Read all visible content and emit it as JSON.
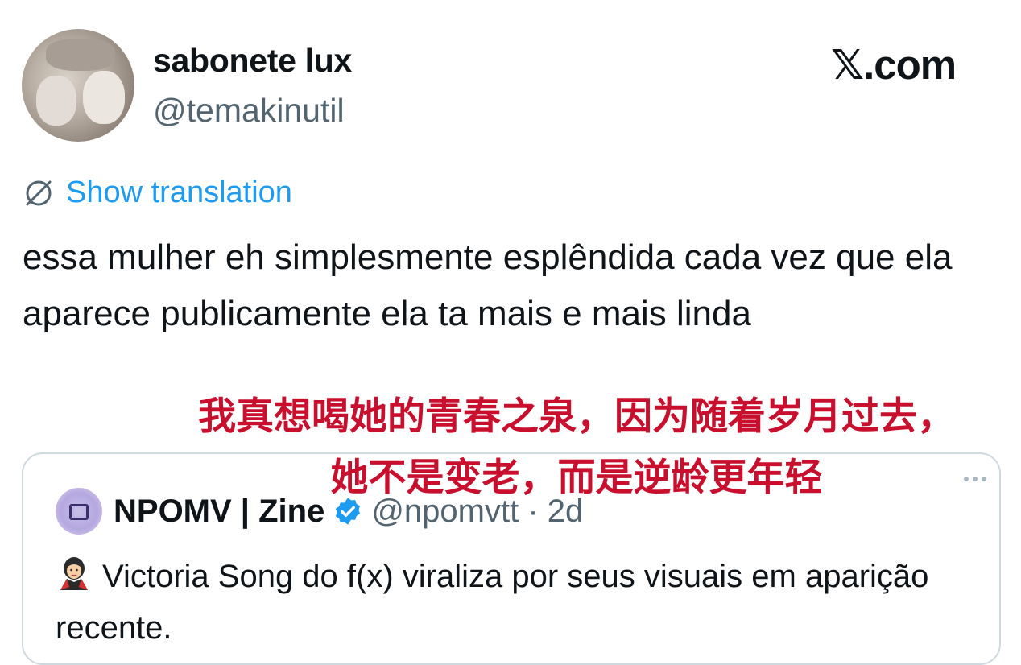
{
  "tweet": {
    "display_name": "sabonete lux",
    "handle": "@temakinutil",
    "brand": "𝕏.com",
    "translation_label": "Show translation",
    "text": "essa mulher eh simplesmente esplêndida cada vez que ela aparece publicamente ela ta mais e mais linda"
  },
  "overlay_caption": {
    "line1": "我真想喝她的青春之泉，因为随着岁月过去，",
    "line2": "她不是变老，而是逆龄更年轻",
    "color": "#c8102e"
  },
  "quote": {
    "name": "NPOMV | Zine",
    "handle_time": "@npomvtt · 2d",
    "body": "Victoria Song do f(x) viraliza por seus visuais em aparição recente.",
    "emoji_icon": "vampire-woman-emoji"
  },
  "colors": {
    "link": "#1d9bf0",
    "muted": "#536471",
    "verified": "#1d9bf0"
  }
}
